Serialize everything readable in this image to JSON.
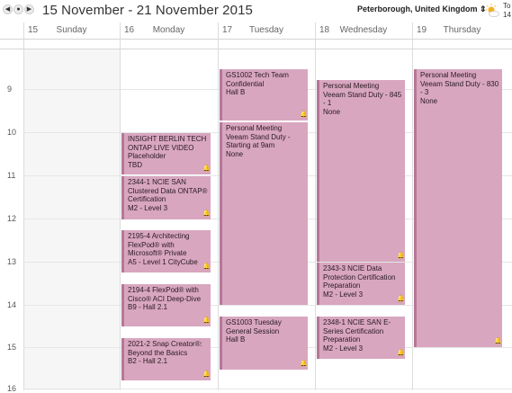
{
  "toolbar": {
    "prev_glyph": "◀",
    "dot_glyph": "●",
    "next_glyph": "▶",
    "title": "15 November - 21 November 2015",
    "location": "Peterborough, United Kingdom",
    "weather_icon": "partly-cloudy-icon",
    "weather_label": "To",
    "weather_temp": "14"
  },
  "days": [
    {
      "num": "15",
      "name": "Sunday"
    },
    {
      "num": "16",
      "name": "Monday"
    },
    {
      "num": "17",
      "name": "Tuesday"
    },
    {
      "num": "18",
      "name": "Wednesday"
    },
    {
      "num": "19",
      "name": "Thursday"
    }
  ],
  "hours": [
    "9",
    "10",
    "11",
    "12",
    "13",
    "14",
    "15",
    "16"
  ],
  "events": [
    {
      "title": "INSIGHT BERLIN TECH ONTAP LIVE VIDEO Placeholder",
      "location": "TBD"
    },
    {
      "title": "2344-1 NCIE SAN Clustered Data ONTAP® Certification",
      "location": "M2 - Level 3"
    },
    {
      "title": "2195-4 Architecting FlexPod® with Microsoft® Private",
      "location": "A5 - Level 1 CityCube"
    },
    {
      "title": "2194-4 FlexPod® with Cisco® ACI Deep-Dive",
      "location": "B9 - Hall 2.1"
    },
    {
      "title": "2021-2 Snap Creator®: Beyond the Basics",
      "location": "B2 - Hall 2.1"
    },
    {
      "title": "GS1002 Tech Team Confidential",
      "location": "Hall B"
    },
    {
      "title": "Personal Meeting Veeam Stand Duty - Starting at 9am",
      "location": "None"
    },
    {
      "title": "GS1003 Tuesday General Session",
      "location": "Hall B"
    },
    {
      "title": "Personal Meeting Veeam Stand Duty - 845 - 1",
      "location": "None"
    },
    {
      "title": "2343-3 NCIE Data Protection Certification Preparation",
      "location": "M2 - Level 3"
    },
    {
      "title": "2348-1 NCIE SAN E-Series Certification Preparation",
      "location": "M2 - Level 3"
    },
    {
      "title": "Personal Meeting Veeam Stand Duty - 830 - 3",
      "location": "None"
    }
  ],
  "alarm_glyph": "🔔",
  "colors": {
    "event_fill": "#d8a6bf",
    "event_border": "#b57797"
  }
}
